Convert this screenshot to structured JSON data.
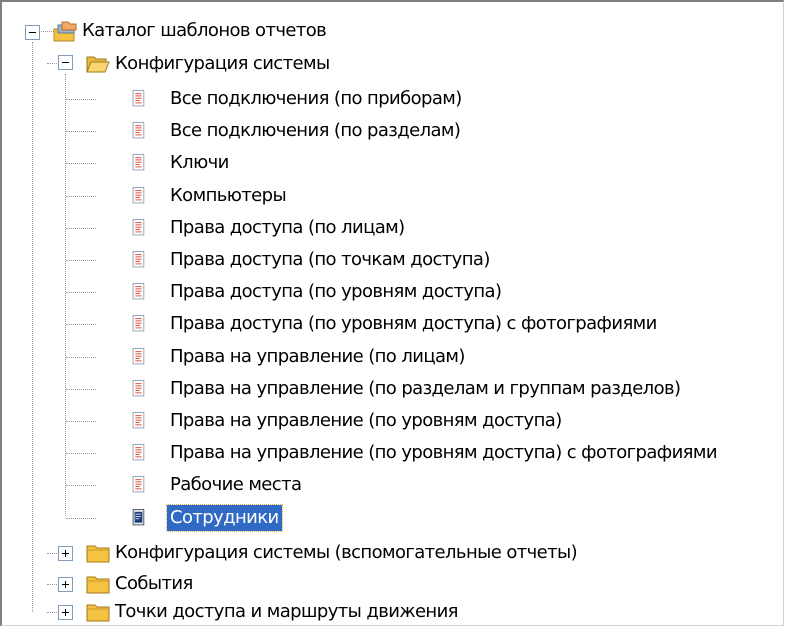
{
  "tree": {
    "root": {
      "label": "Каталог шаблонов отчетов",
      "expanded": true,
      "icon": "catalog-folders-icon"
    },
    "groups": [
      {
        "label": "Конфигурация системы",
        "expanded": true,
        "icon": "folder-open-icon",
        "items": [
          {
            "label": "Все подключения (по приборам)",
            "icon": "report-icon"
          },
          {
            "label": "Все подключения (по разделам)",
            "icon": "report-icon"
          },
          {
            "label": "Ключи",
            "icon": "report-icon"
          },
          {
            "label": "Компьютеры",
            "icon": "report-icon"
          },
          {
            "label": "Права доступа (по лицам)",
            "icon": "report-icon"
          },
          {
            "label": "Права доступа (по точкам доступа)",
            "icon": "report-icon"
          },
          {
            "label": "Права доступа (по уровням доступа)",
            "icon": "report-icon"
          },
          {
            "label": "Права доступа (по уровням доступа) с фотографиями",
            "icon": "report-icon"
          },
          {
            "label": "Права на управление (по лицам)",
            "icon": "report-icon"
          },
          {
            "label": "Права на управление (по разделам и группам разделов)",
            "icon": "report-icon"
          },
          {
            "label": "Права на управление (по уровням доступа)",
            "icon": "report-icon"
          },
          {
            "label": "Права на управление (по уровням доступа) с фотографиями",
            "icon": "report-icon"
          },
          {
            "label": "Рабочие места",
            "icon": "report-icon"
          },
          {
            "label": "Сотрудники",
            "icon": "report-icon",
            "selected": true
          }
        ]
      },
      {
        "label": "Конфигурация системы (вспомогательные отчеты)",
        "expanded": false,
        "icon": "folder-closed-icon"
      },
      {
        "label": "События",
        "expanded": false,
        "icon": "folder-closed-icon"
      },
      {
        "label": "Точки доступа и маршруты движения",
        "expanded": false,
        "icon": "folder-closed-icon"
      }
    ]
  },
  "colors": {
    "selection": "#316ac5",
    "folder": "#f5c242",
    "tree_lines": "#9a9a9a"
  }
}
